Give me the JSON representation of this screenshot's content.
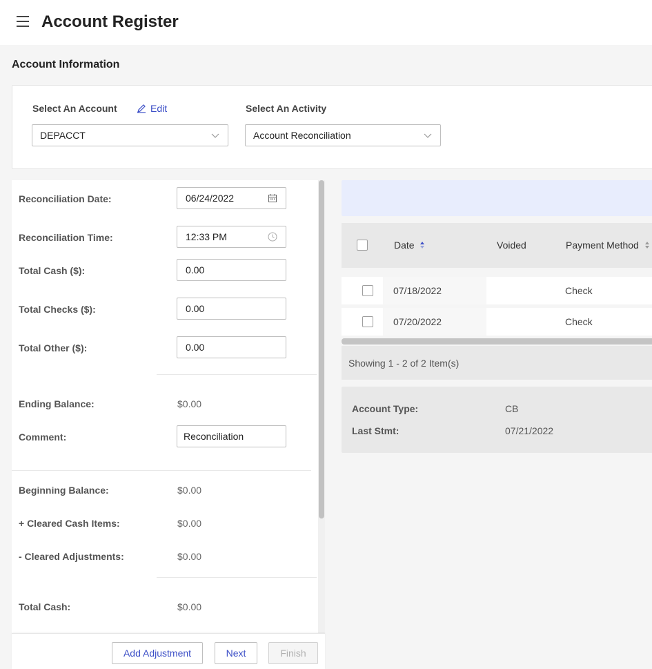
{
  "header": {
    "title": "Account Register"
  },
  "section": {
    "title": "Account Information"
  },
  "account_select": {
    "label": "Select An Account",
    "edit_label": "Edit",
    "value": "DEPACCT"
  },
  "activity_select": {
    "label": "Select An Activity",
    "value": "Account Reconciliation"
  },
  "form": {
    "recon_date": {
      "label": "Reconciliation Date",
      "value": "06/24/2022"
    },
    "recon_time": {
      "label": "Reconciliation Time",
      "value": "12:33 PM"
    },
    "total_cash_input": {
      "label": "Total Cash ($)",
      "value": "0.00"
    },
    "total_checks": {
      "label": "Total Checks ($)",
      "value": "0.00"
    },
    "total_other": {
      "label": "Total Other ($)",
      "value": "0.00"
    },
    "ending_balance": {
      "label": "Ending Balance",
      "value": "$0.00"
    },
    "comment": {
      "label": "Comment",
      "value": "Reconciliation"
    },
    "beginning_balance": {
      "label": "Beginning Balance",
      "value": "$0.00"
    },
    "cleared_cash": {
      "label": "+ Cleared Cash Items",
      "value": "$0.00"
    },
    "cleared_adj": {
      "label": "- Cleared Adjustments",
      "value": "$0.00"
    },
    "total_cash": {
      "label": "Total Cash",
      "value": "$0.00"
    }
  },
  "buttons": {
    "add_adjustment": "Add Adjustment",
    "next": "Next",
    "finish": "Finish"
  },
  "grid": {
    "columns": [
      "Date",
      "Voided",
      "Payment Method"
    ],
    "rows": [
      {
        "date": "07/18/2022",
        "voided": "",
        "payment_method": "Check"
      },
      {
        "date": "07/20/2022",
        "voided": "",
        "payment_method": "Check"
      }
    ],
    "footer": "Showing 1 - 2 of 2 Item(s)"
  },
  "account_details": {
    "account_type_label": "Account Type",
    "account_type_value": "CB",
    "last_stmt_label": "Last Stmt",
    "last_stmt_value": "07/21/2022"
  },
  "colors": {
    "accent": "#3c4fc7",
    "banner": "#e8edfd",
    "panel_gray": "#e8e8e8"
  },
  "icons": [
    "menu-icon",
    "pencil-icon",
    "chevron-down-icon",
    "calendar-icon",
    "clock-icon",
    "sort-icon"
  ]
}
